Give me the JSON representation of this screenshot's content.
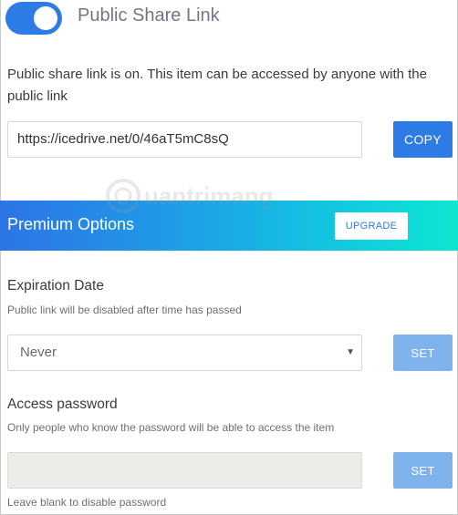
{
  "share": {
    "toggle_on": true,
    "title": "Public Share Link",
    "description": "Public share link is on. This item can be accessed by anyone with the public link",
    "link_value": "https://icedrive.net/0/46aT5mC8sQ",
    "copy_label": "COPY"
  },
  "premium": {
    "title": "Premium Options",
    "upgrade_label": "UPGRADE"
  },
  "expiration": {
    "label": "Expiration Date",
    "help": "Public link will be disabled after time has passed",
    "selected": "Never",
    "set_label": "SET"
  },
  "password": {
    "label": "Access password",
    "help": "Only people who know the password will be able to access the item",
    "value": "",
    "set_label": "SET",
    "footer_help": "Leave blank to disable password"
  },
  "watermark": {
    "text": "Quantrimang"
  },
  "colors": {
    "accent": "#2d7be5",
    "accent_disabled": "#7fb3ee",
    "banner_start": "#2d74e6",
    "banner_end": "#0ee6cf"
  }
}
